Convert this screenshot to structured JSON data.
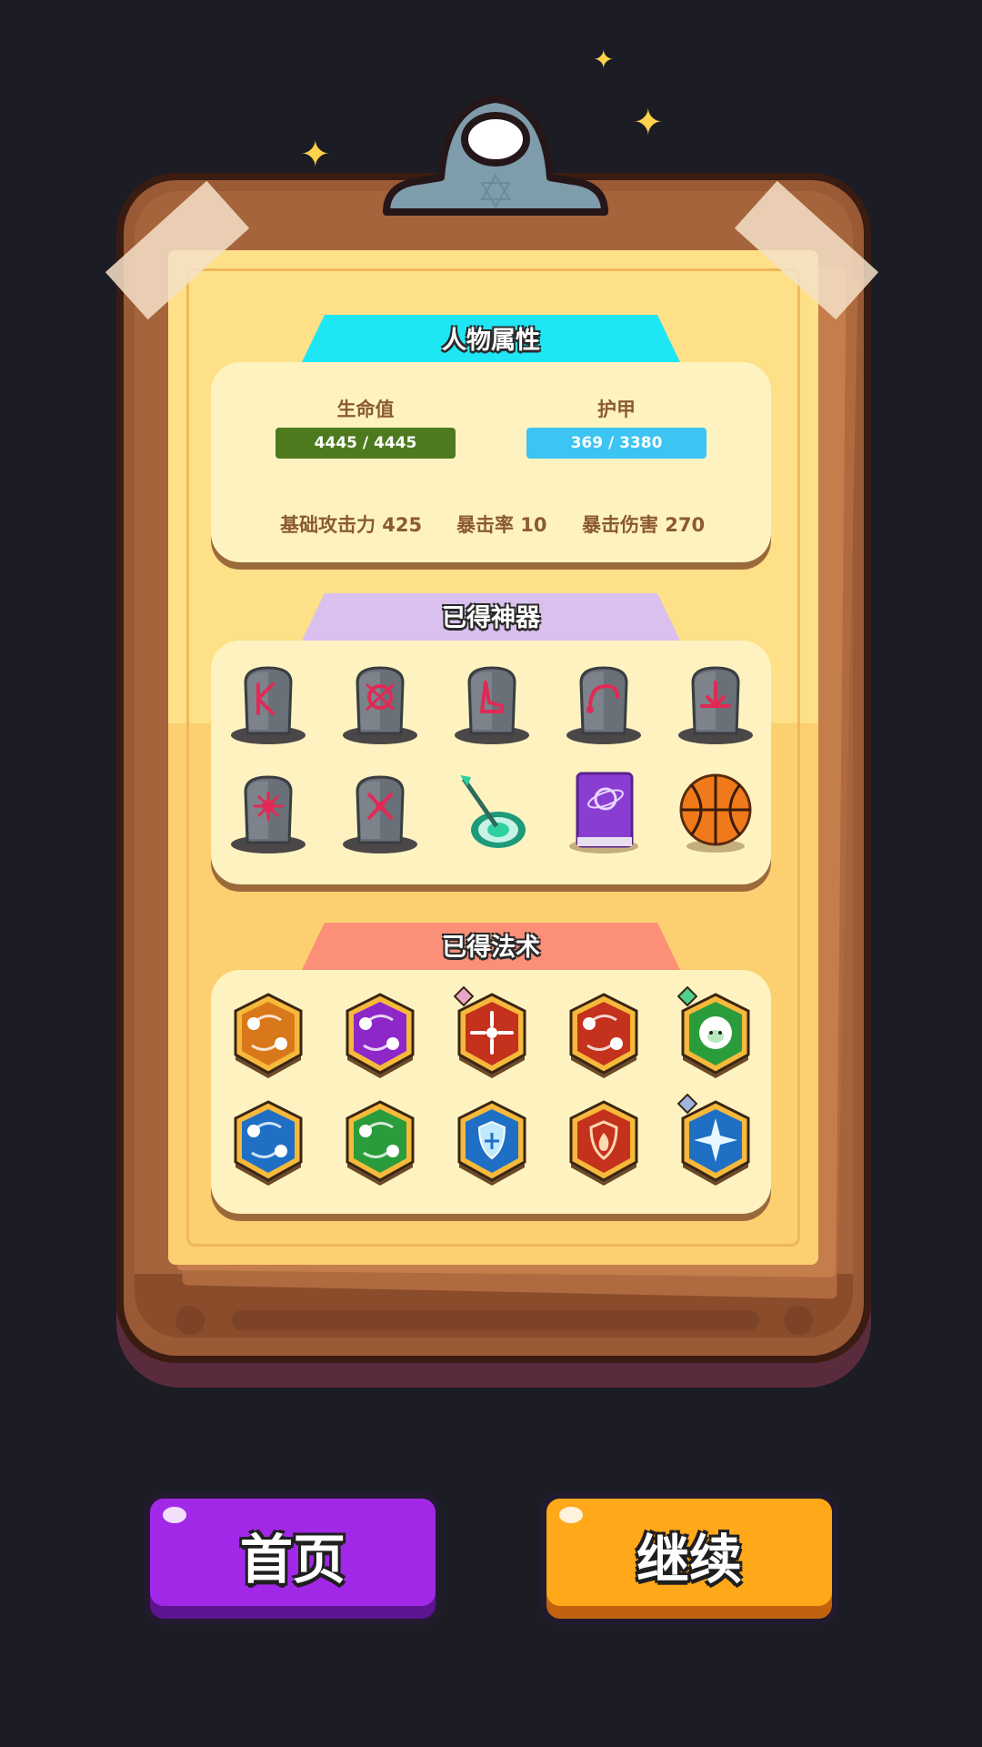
{
  "attributes": {
    "title": "人物属性",
    "hp": {
      "label": "生命值",
      "value": "4445 / 4445",
      "fill": 1.0
    },
    "armor": {
      "label": "护甲",
      "value": "369 / 3380",
      "fill": 1.0
    },
    "base_attack": "基础攻击力 425",
    "crit_rate": "暴击率 10",
    "crit_damage": "暴击伤害 270"
  },
  "artifacts": {
    "title": "已得神器",
    "items": [
      {
        "icon": "rune-k-tombstone-icon",
        "color": "#e02a55"
      },
      {
        "icon": "skull-rune-tombstone-icon",
        "color": "#e02a55"
      },
      {
        "icon": "boot-rune-tombstone-icon",
        "color": "#e02a55"
      },
      {
        "icon": "hook-rune-tombstone-icon",
        "color": "#e02a55"
      },
      {
        "icon": "heart-rune-tombstone-icon",
        "color": "#e02a55"
      },
      {
        "icon": "sun-rune-tombstone-icon",
        "color": "#e02a55"
      },
      {
        "icon": "crossed-arrows-tombstone-icon",
        "color": "#e02a55"
      },
      {
        "icon": "dart-target-icon",
        "color": "#2fcfa0"
      },
      {
        "icon": "spell-book-icon",
        "color": "#8a3ed1"
      },
      {
        "icon": "basketball-icon",
        "color": "#f07a1a"
      }
    ]
  },
  "spells": {
    "title": "已得法术",
    "items": [
      {
        "icon": "orbit-orbs-spell-icon",
        "color": "#d9781a",
        "gem": ""
      },
      {
        "icon": "purple-orbs-spell-icon",
        "color": "#8d27c7",
        "gem": ""
      },
      {
        "icon": "spinning-arrows-spell-icon",
        "color": "#c4311c",
        "gem": "#e8a6c8"
      },
      {
        "icon": "fire-orbs-spell-icon",
        "color": "#c4311c",
        "gem": ""
      },
      {
        "icon": "sheep-spell-icon",
        "color": "#2a9c3c",
        "gem": "#4fd08a"
      },
      {
        "icon": "blue-orbs-spell-icon",
        "color": "#1f6fc4",
        "gem": ""
      },
      {
        "icon": "green-orbs-spell-icon",
        "color": "#2a9c3c",
        "gem": ""
      },
      {
        "icon": "frost-shield-spell-icon",
        "color": "#1f6fc4",
        "gem": ""
      },
      {
        "icon": "flame-shield-spell-icon",
        "color": "#c4311c",
        "gem": ""
      },
      {
        "icon": "ice-star-spell-icon",
        "color": "#1f6fc4",
        "gem": "#9fb4e0"
      }
    ]
  },
  "buttons": {
    "home": "首页",
    "continue": "继续"
  },
  "colors": {
    "hp_bar": "#4d7a1e",
    "armor_bar": "#3cc4f2",
    "tab_attributes": "#1fe6f5",
    "tab_artifacts": "#d9c0ee",
    "tab_spells": "#fb8f78",
    "home_button": "#a228e8",
    "continue_button": "#ffa81a"
  }
}
